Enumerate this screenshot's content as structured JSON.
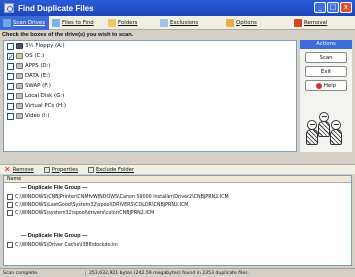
{
  "window": {
    "title": "Find Duplicate Files",
    "min": "_",
    "max": "□",
    "close": "x"
  },
  "toolbar": [
    {
      "label": "Scan Drives",
      "icon": "drives-icon",
      "color": "#6fa8e8"
    },
    {
      "label": "Files to Find",
      "icon": "files-icon",
      "color": "#7fb0e8"
    },
    {
      "label": "Folders",
      "icon": "folders-icon",
      "color": "#e8c96a"
    },
    {
      "label": "Exclusions",
      "icon": "exclusions-icon",
      "color": "#9fc4ec"
    },
    {
      "label": "Options",
      "icon": "options-icon",
      "color": "#e0b24a"
    },
    {
      "label": "Removal",
      "icon": "removal-icon",
      "color": "#d84030"
    }
  ],
  "instruction": "Check the boxes of the drive(s) you wish to scan.",
  "drives": [
    {
      "label": "3½ Floppy (A:)",
      "checked": false,
      "type": "floppy"
    },
    {
      "label": "OS (C:)",
      "checked": true,
      "type": "os"
    },
    {
      "label": "APPS (D:)",
      "checked": false,
      "type": "disk"
    },
    {
      "label": "DATA (E:)",
      "checked": false,
      "type": "disk"
    },
    {
      "label": "SWAP (F:)",
      "checked": false,
      "type": "disk"
    },
    {
      "label": "Local Disk (G:)",
      "checked": false,
      "type": "disk"
    },
    {
      "label": "Virtual PCs (H:)",
      "checked": false,
      "type": "disk"
    },
    {
      "label": "Video (I:)",
      "checked": false,
      "type": "disk"
    }
  ],
  "actions": {
    "header": "Actions",
    "scan": "Scan",
    "exit": "Exit",
    "help": "Help"
  },
  "results_toolbar": {
    "remove": "Remove",
    "properties": "Properties",
    "exclude": "Exclude Folder"
  },
  "results": {
    "column": "Name",
    "groups": [
      {
        "title": "— Duplicate File Group —",
        "files": [
          "C:\\WINDOWS\\CNBJPrinter\\CNMfvWINDOWS\\Canon S9000 Installer\\Driver2\\CNBJPRN2.ICM",
          "C:\\WINDOWS\\LastGood\\System32\\spool\\DRIVERS\\COLOR\\CNBJPRN2.ICM",
          "C:\\WINDOWS\\system32\\spool\\drivers\\color\\CNBJPRN2.ICM"
        ]
      },
      {
        "title": "— Duplicate File Group —",
        "files": [
          "C:\\WINDOWS\\Driver Cache\\i386\\dockdo.ini"
        ]
      }
    ]
  },
  "status": {
    "left": "Scan complete.",
    "right": "253,632,921 bytes (242.59 megabytes) found in 2353 duplicate files."
  }
}
